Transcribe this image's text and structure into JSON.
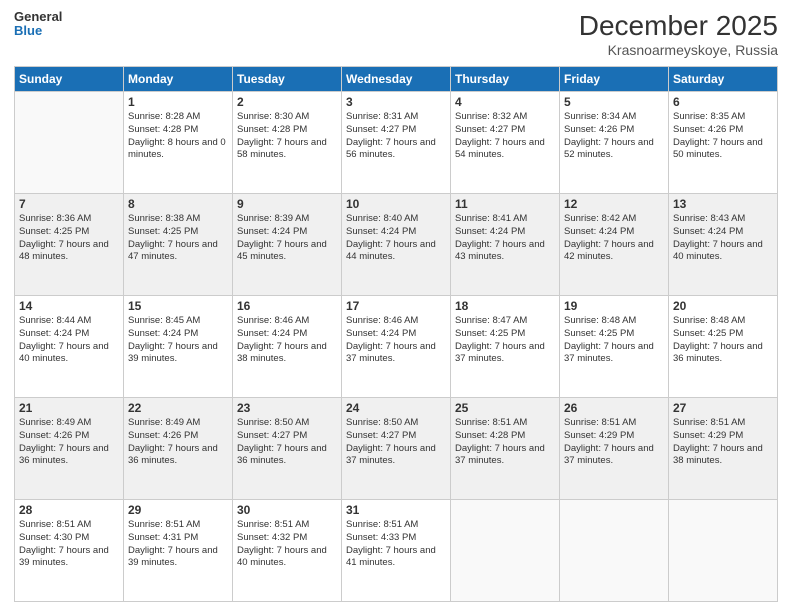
{
  "logo": {
    "line1": "General",
    "line2": "Blue"
  },
  "title": "December 2025",
  "location": "Krasnoarmeyskoye, Russia",
  "weekdays": [
    "Sunday",
    "Monday",
    "Tuesday",
    "Wednesday",
    "Thursday",
    "Friday",
    "Saturday"
  ],
  "weeks": [
    [
      {
        "date": "",
        "sunrise": "",
        "sunset": "",
        "daylight": ""
      },
      {
        "date": "1",
        "sunrise": "Sunrise: 8:28 AM",
        "sunset": "Sunset: 4:28 PM",
        "daylight": "Daylight: 8 hours and 0 minutes."
      },
      {
        "date": "2",
        "sunrise": "Sunrise: 8:30 AM",
        "sunset": "Sunset: 4:28 PM",
        "daylight": "Daylight: 7 hours and 58 minutes."
      },
      {
        "date": "3",
        "sunrise": "Sunrise: 8:31 AM",
        "sunset": "Sunset: 4:27 PM",
        "daylight": "Daylight: 7 hours and 56 minutes."
      },
      {
        "date": "4",
        "sunrise": "Sunrise: 8:32 AM",
        "sunset": "Sunset: 4:27 PM",
        "daylight": "Daylight: 7 hours and 54 minutes."
      },
      {
        "date": "5",
        "sunrise": "Sunrise: 8:34 AM",
        "sunset": "Sunset: 4:26 PM",
        "daylight": "Daylight: 7 hours and 52 minutes."
      },
      {
        "date": "6",
        "sunrise": "Sunrise: 8:35 AM",
        "sunset": "Sunset: 4:26 PM",
        "daylight": "Daylight: 7 hours and 50 minutes."
      }
    ],
    [
      {
        "date": "7",
        "sunrise": "Sunrise: 8:36 AM",
        "sunset": "Sunset: 4:25 PM",
        "daylight": "Daylight: 7 hours and 48 minutes."
      },
      {
        "date": "8",
        "sunrise": "Sunrise: 8:38 AM",
        "sunset": "Sunset: 4:25 PM",
        "daylight": "Daylight: 7 hours and 47 minutes."
      },
      {
        "date": "9",
        "sunrise": "Sunrise: 8:39 AM",
        "sunset": "Sunset: 4:24 PM",
        "daylight": "Daylight: 7 hours and 45 minutes."
      },
      {
        "date": "10",
        "sunrise": "Sunrise: 8:40 AM",
        "sunset": "Sunset: 4:24 PM",
        "daylight": "Daylight: 7 hours and 44 minutes."
      },
      {
        "date": "11",
        "sunrise": "Sunrise: 8:41 AM",
        "sunset": "Sunset: 4:24 PM",
        "daylight": "Daylight: 7 hours and 43 minutes."
      },
      {
        "date": "12",
        "sunrise": "Sunrise: 8:42 AM",
        "sunset": "Sunset: 4:24 PM",
        "daylight": "Daylight: 7 hours and 42 minutes."
      },
      {
        "date": "13",
        "sunrise": "Sunrise: 8:43 AM",
        "sunset": "Sunset: 4:24 PM",
        "daylight": "Daylight: 7 hours and 40 minutes."
      }
    ],
    [
      {
        "date": "14",
        "sunrise": "Sunrise: 8:44 AM",
        "sunset": "Sunset: 4:24 PM",
        "daylight": "Daylight: 7 hours and 40 minutes."
      },
      {
        "date": "15",
        "sunrise": "Sunrise: 8:45 AM",
        "sunset": "Sunset: 4:24 PM",
        "daylight": "Daylight: 7 hours and 39 minutes."
      },
      {
        "date": "16",
        "sunrise": "Sunrise: 8:46 AM",
        "sunset": "Sunset: 4:24 PM",
        "daylight": "Daylight: 7 hours and 38 minutes."
      },
      {
        "date": "17",
        "sunrise": "Sunrise: 8:46 AM",
        "sunset": "Sunset: 4:24 PM",
        "daylight": "Daylight: 7 hours and 37 minutes."
      },
      {
        "date": "18",
        "sunrise": "Sunrise: 8:47 AM",
        "sunset": "Sunset: 4:25 PM",
        "daylight": "Daylight: 7 hours and 37 minutes."
      },
      {
        "date": "19",
        "sunrise": "Sunrise: 8:48 AM",
        "sunset": "Sunset: 4:25 PM",
        "daylight": "Daylight: 7 hours and 37 minutes."
      },
      {
        "date": "20",
        "sunrise": "Sunrise: 8:48 AM",
        "sunset": "Sunset: 4:25 PM",
        "daylight": "Daylight: 7 hours and 36 minutes."
      }
    ],
    [
      {
        "date": "21",
        "sunrise": "Sunrise: 8:49 AM",
        "sunset": "Sunset: 4:26 PM",
        "daylight": "Daylight: 7 hours and 36 minutes."
      },
      {
        "date": "22",
        "sunrise": "Sunrise: 8:49 AM",
        "sunset": "Sunset: 4:26 PM",
        "daylight": "Daylight: 7 hours and 36 minutes."
      },
      {
        "date": "23",
        "sunrise": "Sunrise: 8:50 AM",
        "sunset": "Sunset: 4:27 PM",
        "daylight": "Daylight: 7 hours and 36 minutes."
      },
      {
        "date": "24",
        "sunrise": "Sunrise: 8:50 AM",
        "sunset": "Sunset: 4:27 PM",
        "daylight": "Daylight: 7 hours and 37 minutes."
      },
      {
        "date": "25",
        "sunrise": "Sunrise: 8:51 AM",
        "sunset": "Sunset: 4:28 PM",
        "daylight": "Daylight: 7 hours and 37 minutes."
      },
      {
        "date": "26",
        "sunrise": "Sunrise: 8:51 AM",
        "sunset": "Sunset: 4:29 PM",
        "daylight": "Daylight: 7 hours and 37 minutes."
      },
      {
        "date": "27",
        "sunrise": "Sunrise: 8:51 AM",
        "sunset": "Sunset: 4:29 PM",
        "daylight": "Daylight: 7 hours and 38 minutes."
      }
    ],
    [
      {
        "date": "28",
        "sunrise": "Sunrise: 8:51 AM",
        "sunset": "Sunset: 4:30 PM",
        "daylight": "Daylight: 7 hours and 39 minutes."
      },
      {
        "date": "29",
        "sunrise": "Sunrise: 8:51 AM",
        "sunset": "Sunset: 4:31 PM",
        "daylight": "Daylight: 7 hours and 39 minutes."
      },
      {
        "date": "30",
        "sunrise": "Sunrise: 8:51 AM",
        "sunset": "Sunset: 4:32 PM",
        "daylight": "Daylight: 7 hours and 40 minutes."
      },
      {
        "date": "31",
        "sunrise": "Sunrise: 8:51 AM",
        "sunset": "Sunset: 4:33 PM",
        "daylight": "Daylight: 7 hours and 41 minutes."
      },
      {
        "date": "",
        "sunrise": "",
        "sunset": "",
        "daylight": ""
      },
      {
        "date": "",
        "sunrise": "",
        "sunset": "",
        "daylight": ""
      },
      {
        "date": "",
        "sunrise": "",
        "sunset": "",
        "daylight": ""
      }
    ]
  ],
  "colors": {
    "header_bg": "#1a6fb5",
    "header_text": "#ffffff",
    "even_row": "#f0f0f0",
    "odd_row": "#ffffff"
  }
}
